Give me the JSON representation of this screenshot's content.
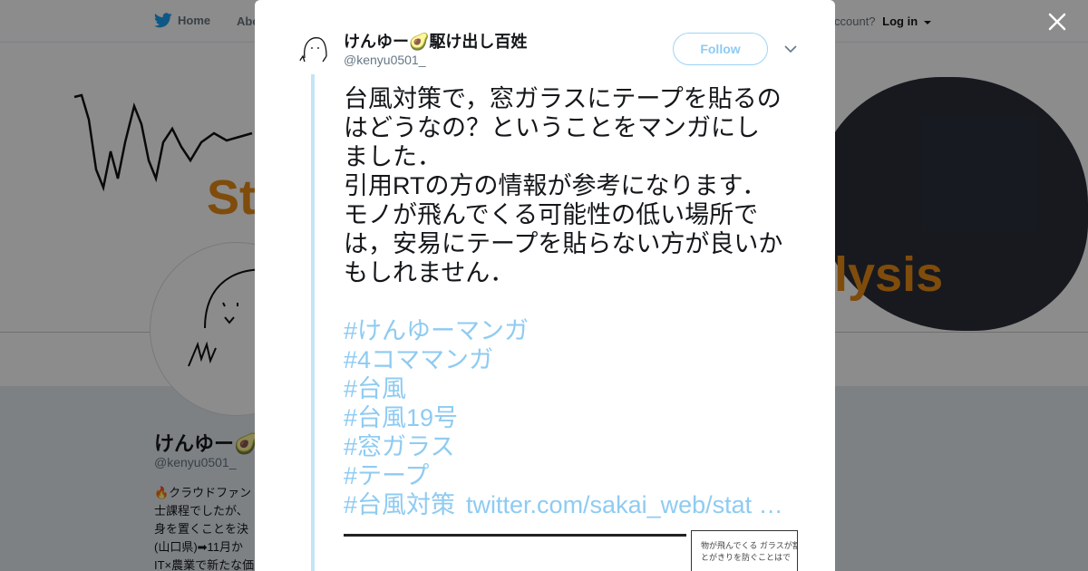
{
  "topnav": {
    "home_label": "Home",
    "about_label": "Abo",
    "login_prompt": "ccount?",
    "login_label": "Log in"
  },
  "banner": {
    "left_text": "St",
    "right_text": "lysis"
  },
  "profile": {
    "name": "けんゆー🥑",
    "handle": "@kenyu0501_",
    "bio_lines": [
      "🔥クラウドファン",
      "士課程でしたが、",
      "身を置くことを決",
      "(山口県)➡11月か",
      "IT×農業で新たな価"
    ]
  },
  "tweet": {
    "author_name": "けんゆー🥑駆け出し百姓",
    "author_handle": "@kenyu0501_",
    "follow_label": "Follow",
    "text_lines": [
      "台風対策で，窓ガラスにテープを貼るの",
      "はどうなの？ということをマンガにし",
      "ました．",
      "引用RTの方の情報が参考になります．",
      "モノが飛んでくる可能性の低い場所で",
      "は，安易にテープを貼らない方が良いか",
      "もしれません．"
    ],
    "hashtags": [
      "#けんゆーマンガ",
      "#4コママンガ",
      "#台風",
      "#台風19号",
      "#窓ガラス",
      "#テープ",
      "#台風対策"
    ],
    "link": "twitter.com/sakai_web/stat …",
    "manga_panel_lines": [
      "物が飛んでくる ガラスが割",
      "とがきりを防ぐことはで"
    ]
  },
  "colors": {
    "twitter_blue": "#1da1f2",
    "link_faded": "#8ecbf2",
    "thread_line": "#c4e4f7",
    "banner_orange": "#e88a17",
    "overlay": "rgba(0,0,0,0.45)"
  },
  "icons": [
    "twitter-bird-icon",
    "caret-down-icon",
    "close-icon",
    "chevron-down-icon"
  ]
}
